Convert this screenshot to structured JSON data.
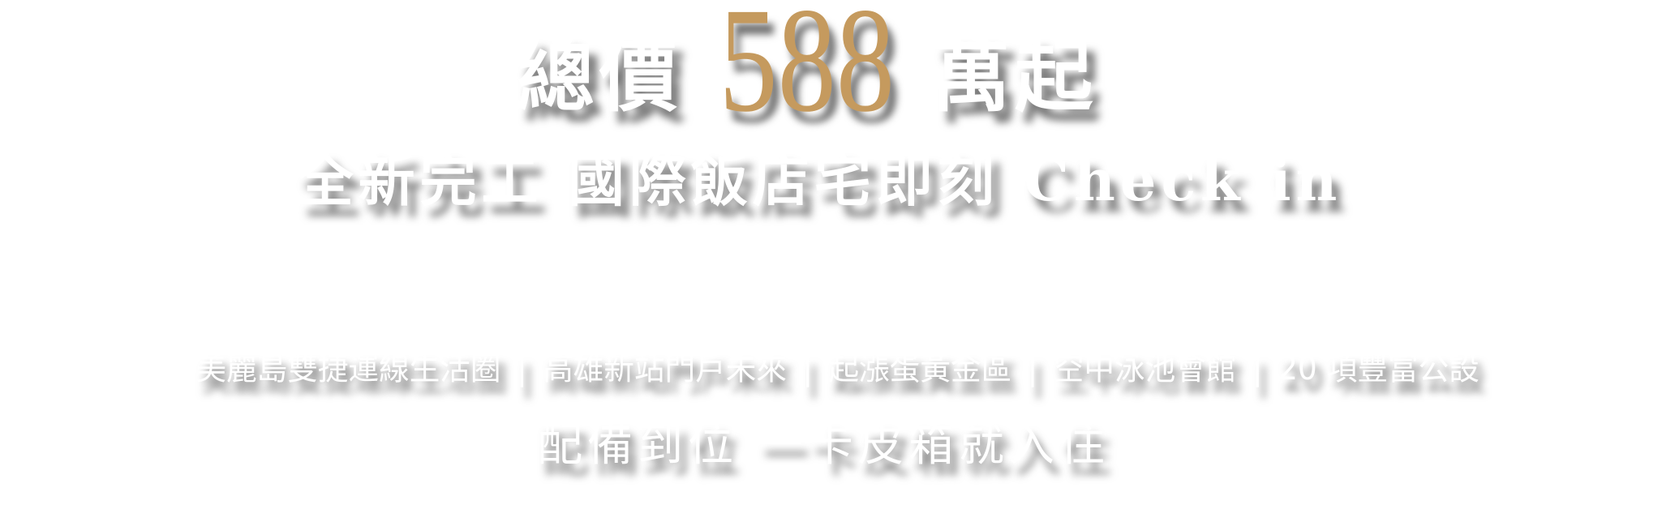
{
  "headline": {
    "prefix": "總價",
    "price": "588",
    "suffix": "萬起",
    "price_color": "#C59A5E"
  },
  "subheadline": "全新完工 國際飯店宅即刻 Check in",
  "features": [
    "美麗島雙捷運線生活圈",
    "高雄新站門戶未來",
    "起漲蛋黃金區",
    "空中泳池會館",
    "20 項豐富公設"
  ],
  "separator": "|",
  "tagline": "配備到位 一卡皮箱就入住"
}
